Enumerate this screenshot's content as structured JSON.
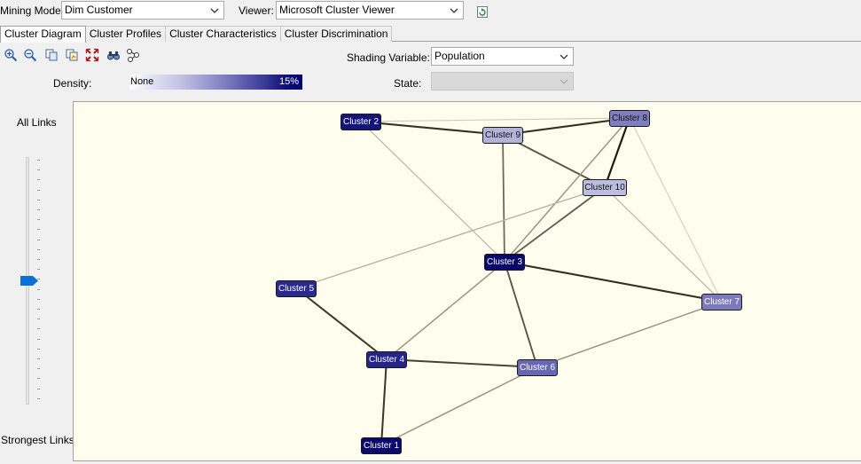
{
  "toolbar": {
    "mining_model_label": "Mining Model:",
    "mining_model_value": "Dim Customer",
    "viewer_label": "Viewer:",
    "viewer_value": "Microsoft Cluster Viewer",
    "refresh_icon": "refresh-icon"
  },
  "tabs": [
    {
      "label": "Cluster Diagram",
      "active": true
    },
    {
      "label": "Cluster Profiles",
      "active": false
    },
    {
      "label": "Cluster Characteristics",
      "active": false
    },
    {
      "label": "Cluster Discrimination",
      "active": false
    }
  ],
  "tools": [
    "zoom-in-icon",
    "zoom-out-icon",
    "copy-icon",
    "copy-graph-icon",
    "fit-to-window-icon",
    "find-node-icon",
    "layout-icon"
  ],
  "shading": {
    "label": "Shading Variable:",
    "value": "Population",
    "state_label": "State:",
    "state_value": ""
  },
  "density": {
    "label": "Density:",
    "min_label": "None",
    "max_label": "15%"
  },
  "slider": {
    "top_label": "All Links",
    "bottom_label": "Strongest Links",
    "value": 0.5
  },
  "colors": {
    "accent": "#0a6fd6",
    "canvas_bg": "#fffdee",
    "dark_node": "#0c0c72"
  },
  "clusters": [
    {
      "id": "c2",
      "label": "Cluster 2",
      "fill": "#14147a"
    },
    {
      "id": "c9",
      "label": "Cluster 9",
      "fill": "#b3b3da"
    },
    {
      "id": "c8",
      "label": "Cluster 8",
      "fill": "#7f7fc0"
    },
    {
      "id": "c10",
      "label": "Cluster 10",
      "fill": "#bdbde0"
    },
    {
      "id": "c3",
      "label": "Cluster 3",
      "fill": "#08086c"
    },
    {
      "id": "c5",
      "label": "Cluster 5",
      "fill": "#2a2a8e"
    },
    {
      "id": "c7",
      "label": "Cluster 7",
      "fill": "#7a7abd"
    },
    {
      "id": "c4",
      "label": "Cluster 4",
      "fill": "#24248a"
    },
    {
      "id": "c6",
      "label": "Cluster 6",
      "fill": "#6767b4"
    },
    {
      "id": "c1",
      "label": "Cluster 1",
      "fill": "#0a0a6e"
    }
  ],
  "links": [
    {
      "from": "c2",
      "to": "c9",
      "strength": 0.9
    },
    {
      "from": "c2",
      "to": "c3",
      "strength": 0.15
    },
    {
      "from": "c2",
      "to": "c8",
      "strength": 0.05
    },
    {
      "from": "c9",
      "to": "c8",
      "strength": 0.9
    },
    {
      "from": "c9",
      "to": "c10",
      "strength": 0.7
    },
    {
      "from": "c9",
      "to": "c3",
      "strength": 0.6
    },
    {
      "from": "c8",
      "to": "c10",
      "strength": 1.0
    },
    {
      "from": "c8",
      "to": "c3",
      "strength": 0.35
    },
    {
      "from": "c10",
      "to": "c3",
      "strength": 0.65
    },
    {
      "from": "c10",
      "to": "c5",
      "strength": 0.2
    },
    {
      "from": "c10",
      "to": "c7",
      "strength": 0.15
    },
    {
      "from": "c8",
      "to": "c7",
      "strength": 0.04
    },
    {
      "from": "c3",
      "to": "c7",
      "strength": 0.9
    },
    {
      "from": "c3",
      "to": "c6",
      "strength": 0.7
    },
    {
      "from": "c3",
      "to": "c4",
      "strength": 0.35
    },
    {
      "from": "c5",
      "to": "c4",
      "strength": 0.85
    },
    {
      "from": "c4",
      "to": "c6",
      "strength": 0.8
    },
    {
      "from": "c4",
      "to": "c1",
      "strength": 0.85
    },
    {
      "from": "c6",
      "to": "c7",
      "strength": 0.35
    },
    {
      "from": "c6",
      "to": "c1",
      "strength": 0.35
    }
  ]
}
